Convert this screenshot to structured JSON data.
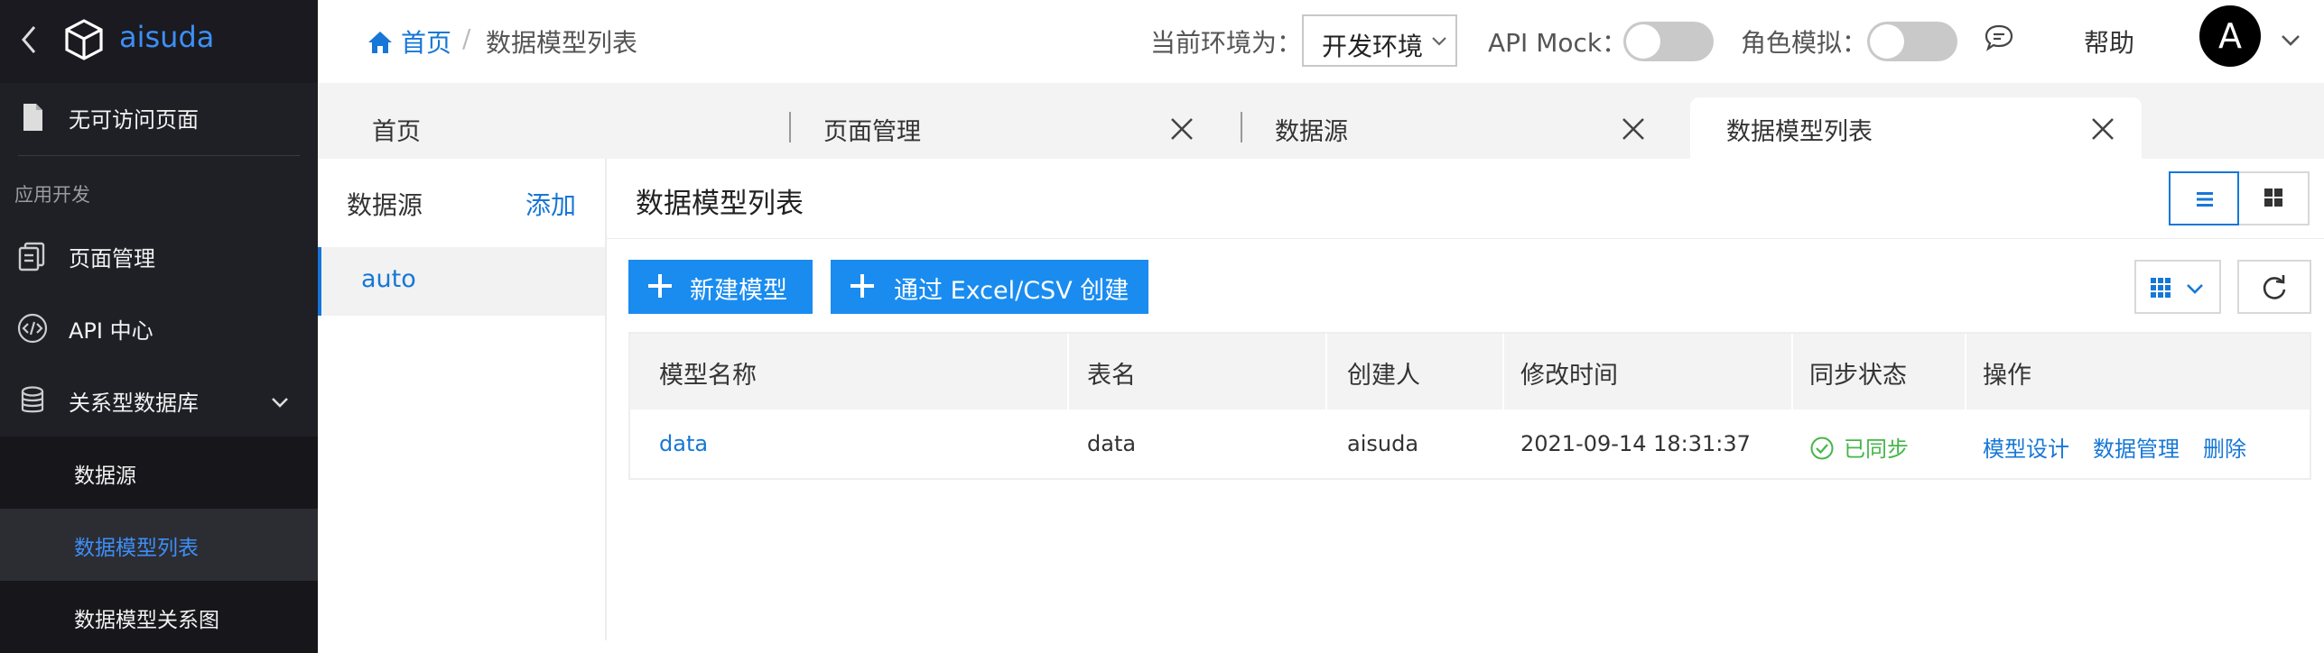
{
  "app": {
    "name": "aisuda"
  },
  "sidebar": {
    "no_access_label": "无可访问页面",
    "group_label": "应用开发",
    "items": [
      {
        "label": "页面管理"
      },
      {
        "label": "API 中心"
      },
      {
        "label": "关系型数据库"
      }
    ],
    "sub_items": [
      {
        "label": "数据源",
        "active": false
      },
      {
        "label": "数据模型列表",
        "active": true
      },
      {
        "label": "数据模型关系图",
        "active": false
      }
    ]
  },
  "header": {
    "breadcrumb_home": "首页",
    "breadcrumb_sep": "/",
    "breadcrumb_current": "数据模型列表",
    "env_label": "当前环境为：",
    "env_value": "开发环境",
    "api_mock_label": "API Mock：",
    "api_mock_on": false,
    "role_sim_label": "角色模拟：",
    "role_sim_on": false,
    "help_label": "帮助",
    "avatar_letter": "A"
  },
  "tabs": [
    {
      "label": "首页",
      "closable": false,
      "active": false
    },
    {
      "label": "页面管理",
      "closable": true,
      "active": false
    },
    {
      "label": "数据源",
      "closable": true,
      "active": false
    },
    {
      "label": "数据模型列表",
      "closable": true,
      "active": true
    }
  ],
  "datasource_panel": {
    "title": "数据源",
    "add_label": "添加",
    "items": [
      {
        "label": "auto",
        "active": true
      }
    ]
  },
  "main": {
    "title": "数据模型列表",
    "new_model_label": "新建模型",
    "import_label": "通过 Excel/CSV 创建",
    "view_mode": "list"
  },
  "table": {
    "columns": [
      "模型名称",
      "表名",
      "创建人",
      "修改时间",
      "同步状态",
      "操作"
    ],
    "rows": [
      {
        "model_name": "data",
        "table_name": "data",
        "creator": "aisuda",
        "modified": "2021-09-14 18:31:37",
        "sync_status": "已同步",
        "actions": [
          "模型设计",
          "数据管理",
          "删除"
        ]
      }
    ]
  },
  "colors": {
    "accent": "#1677d6",
    "primary_button": "#1a8cf0",
    "sidebar_bg": "#1f1f26",
    "success": "#45b649"
  }
}
